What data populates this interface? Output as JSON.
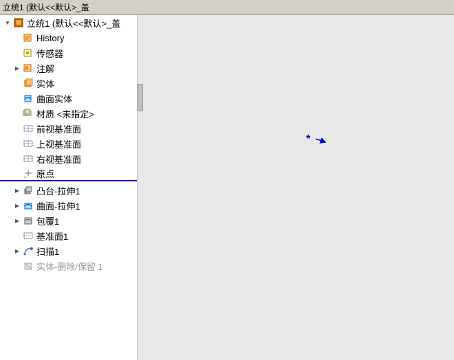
{
  "titleBar": {
    "text": "立统1 (默认<<默认>_盖"
  },
  "sidebar": {
    "rootItem": {
      "label": "立统1 (默认<<默认>_盖",
      "expanded": true
    },
    "items": [
      {
        "id": "history",
        "label": "History",
        "indent": 1,
        "icon": "history",
        "expandable": false
      },
      {
        "id": "sensor",
        "label": "传感器",
        "indent": 1,
        "icon": "sensor",
        "expandable": false
      },
      {
        "id": "annotation",
        "label": "注解",
        "indent": 1,
        "icon": "note",
        "expandable": true,
        "collapsed": true
      },
      {
        "id": "solid",
        "label": "实体",
        "indent": 1,
        "icon": "solid",
        "expandable": false
      },
      {
        "id": "surface-solid",
        "label": "曲面实体",
        "indent": 1,
        "icon": "surface",
        "expandable": false
      },
      {
        "id": "material",
        "label": "材质 <未指定>",
        "indent": 1,
        "icon": "material",
        "expandable": false
      },
      {
        "id": "front-plane",
        "label": "前视基准面",
        "indent": 1,
        "icon": "plane",
        "expandable": false
      },
      {
        "id": "top-plane",
        "label": "上视基准面",
        "indent": 1,
        "icon": "plane",
        "expandable": false
      },
      {
        "id": "right-plane",
        "label": "右视基准面",
        "indent": 1,
        "icon": "plane",
        "expandable": false
      },
      {
        "id": "origin",
        "label": "原点",
        "indent": 1,
        "icon": "origin",
        "expandable": false
      },
      {
        "id": "boss-extrude",
        "label": "凸台-拉伸1",
        "indent": 1,
        "icon": "boss",
        "expandable": true,
        "collapsed": true
      },
      {
        "id": "surface-extrude",
        "label": "曲面-拉伸1",
        "indent": 1,
        "icon": "surface2",
        "expandable": true,
        "collapsed": true
      },
      {
        "id": "wrap",
        "label": "包覆1",
        "indent": 1,
        "icon": "wrap",
        "expandable": true,
        "collapsed": true
      },
      {
        "id": "base-plane",
        "label": "基准面1",
        "indent": 1,
        "icon": "baseplane",
        "expandable": false,
        "disabled": false
      },
      {
        "id": "sweep",
        "label": "扫描1",
        "indent": 1,
        "icon": "sweep",
        "expandable": true,
        "collapsed": true
      },
      {
        "id": "cut",
        "label": "实体-删除/保留 1",
        "indent": 1,
        "icon": "cut",
        "expandable": false,
        "disabled": true
      }
    ]
  },
  "canvas": {
    "background": "#e8e8e8"
  }
}
